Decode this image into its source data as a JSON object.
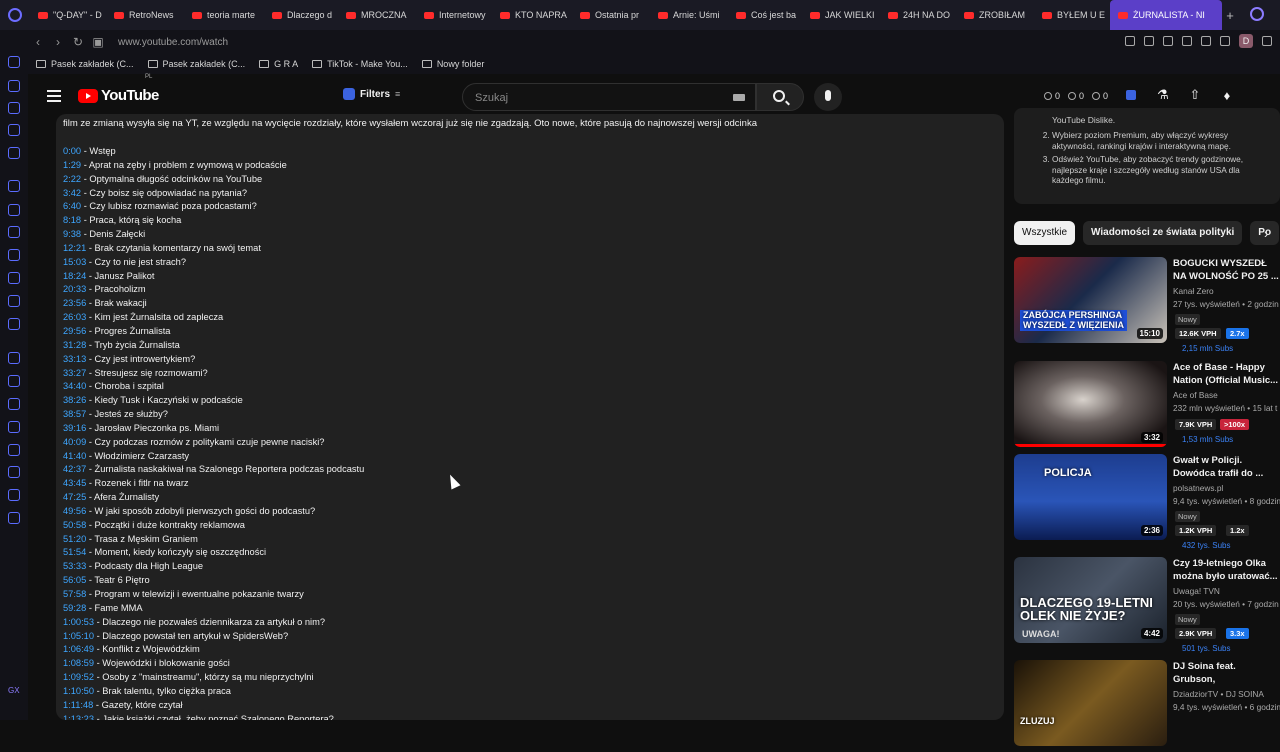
{
  "browser": {
    "tabs": [
      {
        "label": "\"Q-DAY\" - D"
      },
      {
        "label": "RetroNews"
      },
      {
        "label": "teoria marte"
      },
      {
        "label": "Dlaczego d"
      },
      {
        "label": "MROCZNA"
      },
      {
        "label": "Internetowy"
      },
      {
        "label": "KTO NAPRA"
      },
      {
        "label": "Ostatnia pr"
      },
      {
        "label": "Arnie: Uśmi"
      },
      {
        "label": "Coś jest ba"
      },
      {
        "label": "JAK WIELKI"
      },
      {
        "label": "24H NA DO"
      },
      {
        "label": "ZROBIŁAM"
      },
      {
        "label": "BYŁEM U E"
      },
      {
        "label": "ŻURNALISTA - NI"
      }
    ],
    "url": "www.youtube.com/watch",
    "profile_initial": "D",
    "bookmarks": [
      {
        "label": "Pasek zakładek (C..."
      },
      {
        "label": "Pasek zakładek (C..."
      },
      {
        "label": "G R A"
      },
      {
        "label": "TikTok - Make You..."
      },
      {
        "label": "Nowy folder"
      }
    ],
    "sidebar_bottom": "GX"
  },
  "header": {
    "logo_text": "YouTube",
    "country_code": "PL",
    "filters_label": "Filters",
    "search_placeholder": "Szukaj",
    "stats": [
      "0",
      "0",
      "0"
    ]
  },
  "description": {
    "intro": "film ze zmianą wysyła się na YT, ze względu na wycięcie rozdziały, które wysłałem wczoraj już się nie zgadzają. Oto nowe, które pasują do najnowszej wersji odcinka",
    "chapters": [
      {
        "time": "0:00",
        "title": " - Wstęp"
      },
      {
        "time": "1:29",
        "title": " - Aprat na zęby i problem z wymową w podcaście"
      },
      {
        "time": "2:22",
        "title": " - Optymalna długość odcinków na YouTube"
      },
      {
        "time": "3:42",
        "title": " - Czy boisz się odpowiadać na pytania?"
      },
      {
        "time": "6:40",
        "title": " - Czy lubisz rozmawiać poza podcastami?"
      },
      {
        "time": "8:18",
        "title": " - Praca, którą się kocha"
      },
      {
        "time": "9:38",
        "title": " - Denis Załęcki"
      },
      {
        "time": "12:21",
        "title": " - Brak czytania komentarzy na swój temat"
      },
      {
        "time": "15:03",
        "title": " - Czy to nie jest strach?"
      },
      {
        "time": "18:24",
        "title": " - Janusz Palikot"
      },
      {
        "time": "20:33",
        "title": " - Pracoholizm"
      },
      {
        "time": "23:56",
        "title": " - Brak wakacji"
      },
      {
        "time": "26:03",
        "title": " - Kim jest Żurnalsita od zaplecza"
      },
      {
        "time": "29:56",
        "title": " - Progres Żurnalista"
      },
      {
        "time": "31:28",
        "title": " - Tryb życia Żurnalista"
      },
      {
        "time": "33:13",
        "title": " - Czy jest introwertykiem?"
      },
      {
        "time": "33:27",
        "title": " - Stresujesz się rozmowami?"
      },
      {
        "time": "34:40",
        "title": " - Choroba i szpital"
      },
      {
        "time": "38:26",
        "title": " - Kiedy Tusk i Kaczyński w podcaście"
      },
      {
        "time": "38:57",
        "title": " - Jesteś ze służby?"
      },
      {
        "time": "39:16",
        "title": " - Jarosław Pieczonka ps. Miami"
      },
      {
        "time": "40:09",
        "title": " - Czy podczas rozmów z politykami czuje pewne naciski?"
      },
      {
        "time": "41:40",
        "title": " - Włodzimierz Czarzasty"
      },
      {
        "time": "42:37",
        "title": " - Żurnalista naskakiwał na Szalonego Reportera podczas podcastu"
      },
      {
        "time": "43:45",
        "title": " - Rozenek i fitlr na twarz"
      },
      {
        "time": "47:25",
        "title": " - Afera Żurnalisty"
      },
      {
        "time": "49:56",
        "title": " - W jaki sposób zdobyli pierwszych gości do podcastu?"
      },
      {
        "time": "50:58",
        "title": " - Początki i duże kontrakty reklamowa"
      },
      {
        "time": "51:20",
        "title": " - Trasa z Męskim Graniem"
      },
      {
        "time": "51:54",
        "title": " - Moment, kiedy kończyły się oszczędności"
      },
      {
        "time": "53:33",
        "title": " - Podcasty dla High League"
      },
      {
        "time": "56:05",
        "title": " - Teatr 6 Piętro"
      },
      {
        "time": "57:58",
        "title": " - Program w telewizji i ewentualne pokazanie twarzy"
      },
      {
        "time": "59:28",
        "title": " - Fame MMA"
      },
      {
        "time": "1:00:53",
        "title": " - Dlaczego nie pozwałeś dziennikarza za artykuł o nim?"
      },
      {
        "time": "1:05:10",
        "title": " - Dlaczego powstał ten artykuł w SpidersWeb?"
      },
      {
        "time": "1:06:49",
        "title": " - Konflikt z Wojewódzkim"
      },
      {
        "time": "1:08:59",
        "title": " - Wojewódzki i blokowanie gości"
      },
      {
        "time": "1:09:52",
        "title": " - Osoby z \"mainstreamu\", którzy są mu nieprzychylni"
      },
      {
        "time": "1:10:50",
        "title": " - Brak talentu, tylko ciężka praca"
      },
      {
        "time": "1:11:48",
        "title": " - Gazety, które czytał"
      },
      {
        "time": "1:13:23",
        "title": " - Jakie książki czytał, żeby poznać Szalonego Reportera?"
      }
    ]
  },
  "dislike_panel": {
    "line0": "YouTube Dislike.",
    "items": [
      "Wybierz poziom Premium, aby włączyć wykresy aktywności, rankingi krajów i interaktywną mapę.",
      "Odśwież YouTube, aby zobaczyć trendy godzinowe, najlepsze kraje i szczegóły według stanów USA dla każdego filmu."
    ]
  },
  "chips": [
    {
      "label": "Wszystkie"
    },
    {
      "label": "Wiadomości ze świata polityki"
    },
    {
      "label": "Po"
    }
  ],
  "recommendations": [
    {
      "title": "BOGUCKI WYSZEDŁ NA WOLNOŚĆ PO 25 ...",
      "channel": "Kanał Zero",
      "views": "27 tys. wyświetleń • 2 godzin",
      "new_label": "Nowy",
      "vph": "12.6K VPH",
      "badge": "2.7x",
      "subs": "2,15 mln Subs",
      "duration": "15:10",
      "thumb_text": "ZABÓJCA PERSHINGA WYSZEDŁ Z WIĘZIENIA"
    },
    {
      "title": "Ace of Base - Happy Nation (Official Music...",
      "channel": "Ace of Base",
      "views": "232 mln wyświetleń • 15 lat t",
      "vph": "7.9K VPH",
      "badge": ">100x",
      "subs": "1,53 mln Subs",
      "duration": "3:32"
    },
    {
      "title": "Gwałt w Policji. Dowódca trafił do ...",
      "channel": "polsatnews.pl",
      "views": "9,4 tys. wyświetleń • 8 godzin",
      "new_label": "Nowy",
      "vph": "1.2K VPH",
      "badge": "1.2x",
      "subs": "432 tys. Subs",
      "duration": "2:36",
      "thumb_text": "POLICJA"
    },
    {
      "title": "Czy 19-letniego Olka można było uratować...",
      "channel": "Uwaga! TVN",
      "views": "20 tys. wyświetleń • 7 godzin",
      "new_label": "Nowy",
      "vph": "2.9K VPH",
      "badge": "3.3x",
      "subs": "501 tys. Subs",
      "duration": "4:42",
      "thumb_text": "DLACZEGO 19-LETNI OLEK NIE ŻYJE?",
      "thumb_sub": "UWAGA!"
    },
    {
      "title": "DJ Soina feat. Grubson, donGURALesko - Zluz...",
      "channel": "DziadziorTV • DJ SOINA",
      "views": "9,4 tys. wyświetleń • 6 godzin",
      "thumb_text": "ZLUZUJ"
    }
  ],
  "colors": {
    "accent": "#3ea6ff",
    "active_tab": "#5b3fc8",
    "youtube_red": "#ff0000"
  }
}
